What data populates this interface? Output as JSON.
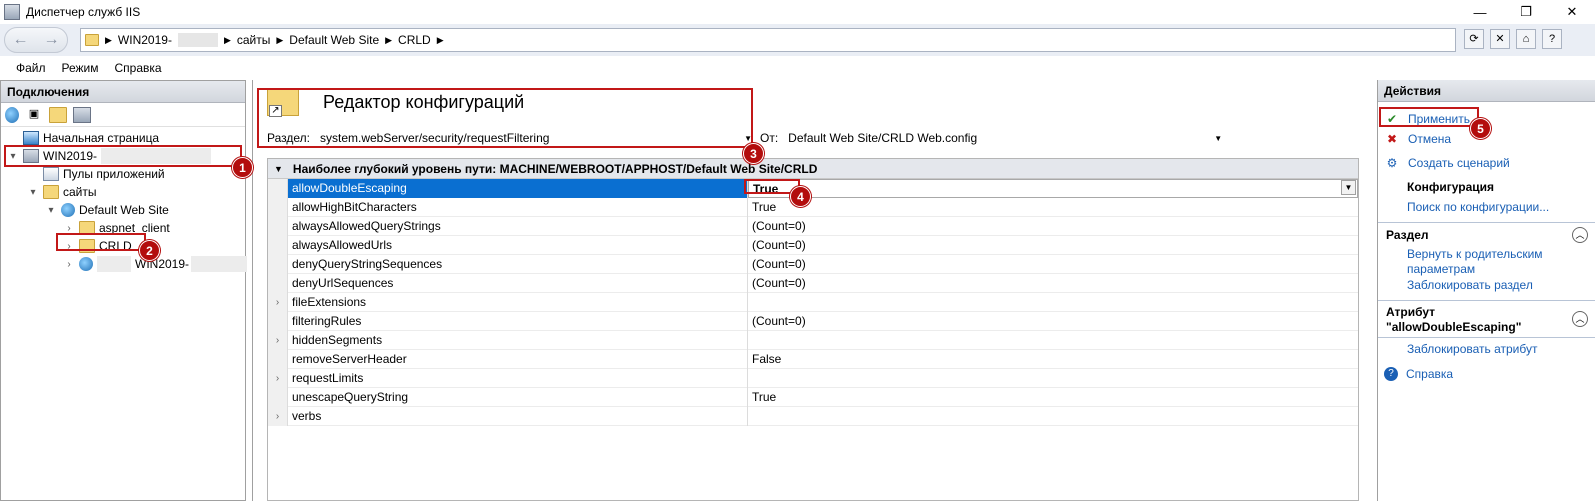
{
  "window": {
    "title": "Диспетчер служб IIS",
    "minimize": "—",
    "maximize": "❐",
    "close": "✕"
  },
  "address": {
    "crumbs": [
      "WIN2019-",
      "сайты",
      "Default Web Site",
      "CRLD"
    ]
  },
  "menu": [
    "Файл",
    "Режим",
    "Справка"
  ],
  "connections": {
    "title": "Подключения",
    "tree": {
      "start_page": "Начальная страница",
      "server": "WIN2019-",
      "app_pools": "Пулы приложений",
      "sites": "сайты",
      "default_site": "Default Web Site",
      "aspnet_client": "aspnet_client",
      "crld": "CRLD",
      "other_site": "WIN2019-"
    }
  },
  "editor": {
    "title": "Редактор конфигураций",
    "section_label": "Раздел:",
    "section_value": "system.webServer/security/requestFiltering",
    "from_label": "От:",
    "from_value": "Default Web Site/CRLD Web.config",
    "grid_header": "Наиболее глубокий уровень пути: MACHINE/WEBROOT/APPHOST/Default Web Site/CRLD",
    "rows": [
      {
        "name": "allowDoubleEscaping",
        "value": "True"
      },
      {
        "name": "allowHighBitCharacters",
        "value": "True"
      },
      {
        "name": "alwaysAllowedQueryStrings",
        "value": "(Count=0)"
      },
      {
        "name": "alwaysAllowedUrls",
        "value": "(Count=0)"
      },
      {
        "name": "denyQueryStringSequences",
        "value": "(Count=0)"
      },
      {
        "name": "denyUrlSequences",
        "value": "(Count=0)"
      },
      {
        "name": "fileExtensions",
        "value": ""
      },
      {
        "name": "filteringRules",
        "value": "(Count=0)"
      },
      {
        "name": "hiddenSegments",
        "value": ""
      },
      {
        "name": "removeServerHeader",
        "value": "False"
      },
      {
        "name": "requestLimits",
        "value": ""
      },
      {
        "name": "unescapeQueryString",
        "value": "True"
      },
      {
        "name": "verbs",
        "value": ""
      }
    ]
  },
  "actions": {
    "title": "Действия",
    "apply": "Применить",
    "cancel": "Отмена",
    "create_script": "Создать сценарий",
    "config_group": "Конфигурация",
    "search_config": "Поиск по конфигурации...",
    "section_group": "Раздел",
    "revert_parent": "Вернуть к родительским параметрам",
    "lock_section": "Заблокировать раздел",
    "attribute_group_line1": "Атрибут",
    "attribute_group_line2": "\"allowDoubleEscaping\"",
    "lock_attribute": "Заблокировать атрибут",
    "help": "Справка"
  },
  "callouts": [
    "1",
    "2",
    "3",
    "4",
    "5"
  ],
  "colors": {
    "selection": "#0a6fd1",
    "link": "#1a5fb4",
    "callout": "#b30d0d"
  }
}
